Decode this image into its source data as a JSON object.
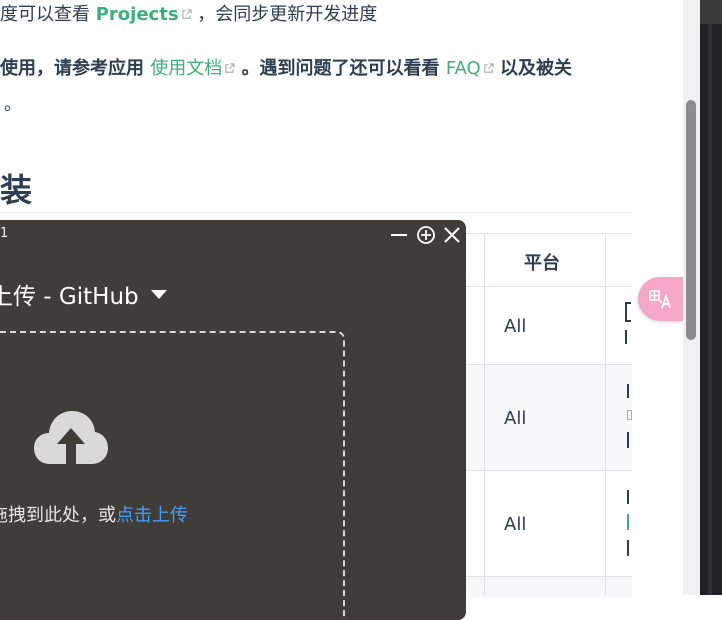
{
  "doc": {
    "line1_prefix": "度可以查看",
    "line1_link": "Projects",
    "line1_suffix": "，会同步更新开发进度",
    "line2_prefix": "使用，请参考应用",
    "line2_link1": "使用文档",
    "line2_mid": "。遇到问题了还可以看看",
    "line2_link2": "FAQ",
    "line2_suffix": "以及被关",
    "line3": "。",
    "heading": "装"
  },
  "table": {
    "header_platform": "平台",
    "rows": [
      {
        "platform": "All"
      },
      {
        "platform": "All"
      },
      {
        "platform": "All"
      }
    ]
  },
  "panel": {
    "version": "1",
    "title": "上传 - GitHub",
    "drop_hint": "拖拽到此处，或",
    "drop_link": "点击上传"
  },
  "colors": {
    "link_green": "#3eaf7c",
    "panel_bg": "#403c38",
    "upload_link": "#409eff",
    "translate_pink": "#f4a7c6"
  },
  "icons": [
    "external-link-icon",
    "minimize-icon",
    "pin-icon",
    "close-icon",
    "cloud-upload-icon",
    "translate-icon",
    "dropdown-caret-icon"
  ]
}
